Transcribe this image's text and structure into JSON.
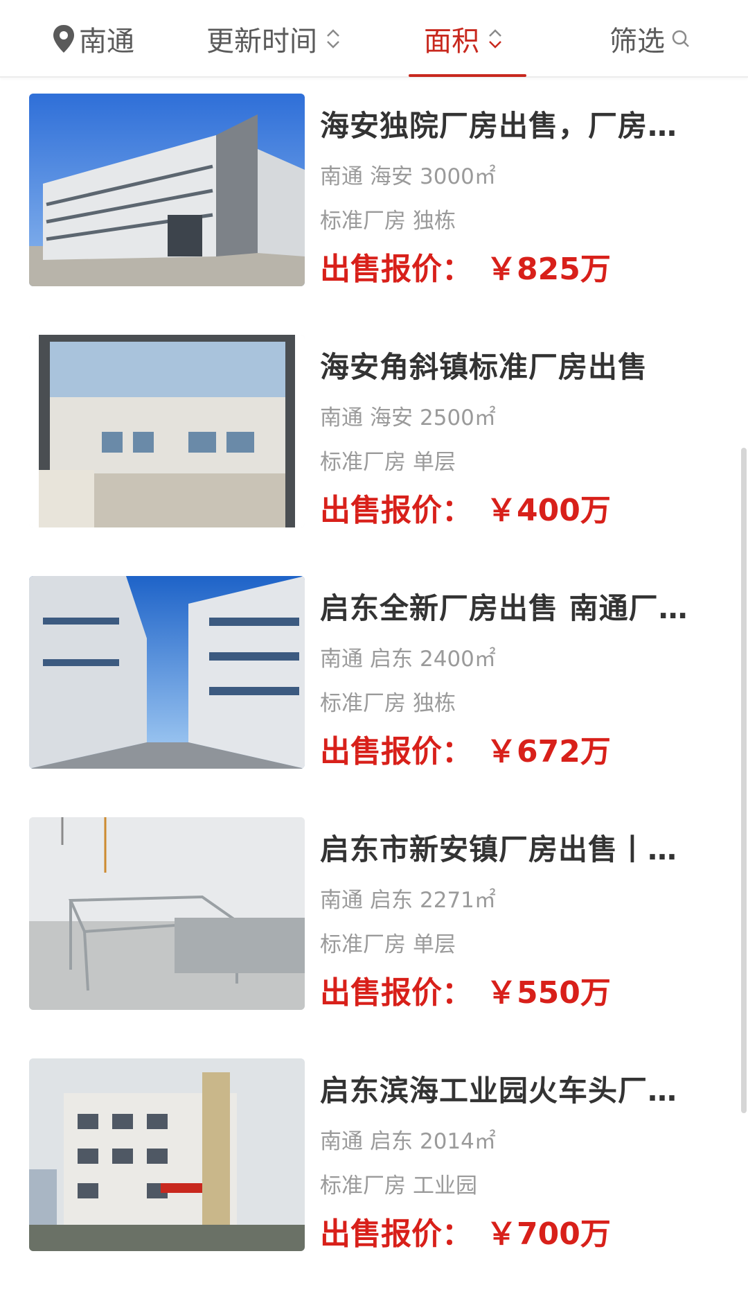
{
  "filter_bar": {
    "location": "南通",
    "update_time": "更新时间",
    "area": "面积",
    "filter": "筛选"
  },
  "colors": {
    "accent": "#c8281e",
    "price": "#d8201a",
    "title": "#333333",
    "meta": "#9a9a9a"
  },
  "listings": [
    {
      "title": "海安独院厂房出售，厂房…",
      "city": "南通",
      "district": "海安",
      "area": "3000㎡",
      "tag1": "标准厂房",
      "tag2": "独栋",
      "price_label": "出售报价：",
      "price": "￥825万"
    },
    {
      "title": "海安角斜镇标准厂房出售",
      "city": "南通",
      "district": "海安",
      "area": "2500㎡",
      "tag1": "标准厂房",
      "tag2": "单层",
      "price_label": "出售报价：",
      "price": "￥400万"
    },
    {
      "title": "启东全新厂房出售 南通厂…",
      "city": "南通",
      "district": "启东",
      "area": "2400㎡",
      "tag1": "标准厂房",
      "tag2": "独栋",
      "price_label": "出售报价：",
      "price": "￥672万"
    },
    {
      "title": "启东市新安镇厂房出售丨…",
      "city": "南通",
      "district": "启东",
      "area": "2271㎡",
      "tag1": "标准厂房",
      "tag2": "单层",
      "price_label": "出售报价：",
      "price": "￥550万"
    },
    {
      "title": "启东滨海工业园火车头厂…",
      "city": "南通",
      "district": "启东",
      "area": "2014㎡",
      "tag1": "标准厂房",
      "tag2": "工业园",
      "price_label": "出售报价：",
      "price": "￥700万"
    }
  ]
}
